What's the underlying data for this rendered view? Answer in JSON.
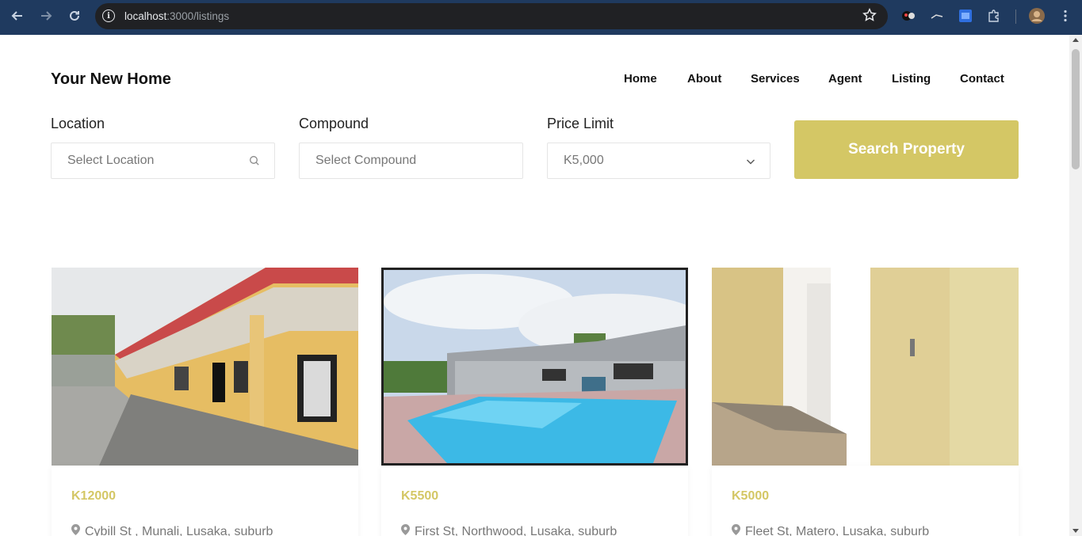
{
  "browser": {
    "url_host": "localhost",
    "url_path": ":3000/listings",
    "back_icon": "arrow-left-icon",
    "forward_icon": "arrow-right-icon",
    "reload_icon": "reload-icon",
    "star_icon": "star-icon"
  },
  "site": {
    "brand": "Your New Home",
    "nav": [
      "Home",
      "About",
      "Services",
      "Agent",
      "Listing",
      "Contact"
    ]
  },
  "search": {
    "location_label": "Location",
    "location_placeholder": "Select Location",
    "compound_label": "Compound",
    "compound_placeholder": "Select Compound",
    "price_label": "Price Limit",
    "price_value": "K5,000",
    "button_label": "Search Property"
  },
  "listings": [
    {
      "price": "K12000",
      "address": "Cybill St , Munali, Lusaka, suburb"
    },
    {
      "price": "K5500",
      "address": "First St, Northwood, Lusaka, suburb"
    },
    {
      "price": "K5000",
      "address": "Fleet St, Matero, Lusaka, suburb"
    }
  ],
  "colors": {
    "accent": "#d4c765",
    "chrome": "#1f3a5f"
  }
}
